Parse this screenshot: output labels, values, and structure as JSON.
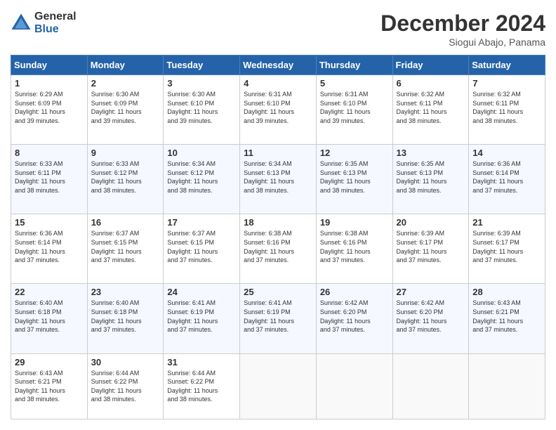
{
  "header": {
    "logo_general": "General",
    "logo_blue": "Blue",
    "month_title": "December 2024",
    "location": "Siogui Abajo, Panama"
  },
  "days_of_week": [
    "Sunday",
    "Monday",
    "Tuesday",
    "Wednesday",
    "Thursday",
    "Friday",
    "Saturday"
  ],
  "weeks": [
    [
      {
        "day": "1",
        "sunrise": "6:29 AM",
        "sunset": "6:09 PM",
        "daylight": "11 hours and 39 minutes."
      },
      {
        "day": "2",
        "sunrise": "6:30 AM",
        "sunset": "6:09 PM",
        "daylight": "11 hours and 39 minutes."
      },
      {
        "day": "3",
        "sunrise": "6:30 AM",
        "sunset": "6:10 PM",
        "daylight": "11 hours and 39 minutes."
      },
      {
        "day": "4",
        "sunrise": "6:31 AM",
        "sunset": "6:10 PM",
        "daylight": "11 hours and 39 minutes."
      },
      {
        "day": "5",
        "sunrise": "6:31 AM",
        "sunset": "6:10 PM",
        "daylight": "11 hours and 39 minutes."
      },
      {
        "day": "6",
        "sunrise": "6:32 AM",
        "sunset": "6:11 PM",
        "daylight": "11 hours and 38 minutes."
      },
      {
        "day": "7",
        "sunrise": "6:32 AM",
        "sunset": "6:11 PM",
        "daylight": "11 hours and 38 minutes."
      }
    ],
    [
      {
        "day": "8",
        "sunrise": "6:33 AM",
        "sunset": "6:11 PM",
        "daylight": "11 hours and 38 minutes."
      },
      {
        "day": "9",
        "sunrise": "6:33 AM",
        "sunset": "6:12 PM",
        "daylight": "11 hours and 38 minutes."
      },
      {
        "day": "10",
        "sunrise": "6:34 AM",
        "sunset": "6:12 PM",
        "daylight": "11 hours and 38 minutes."
      },
      {
        "day": "11",
        "sunrise": "6:34 AM",
        "sunset": "6:13 PM",
        "daylight": "11 hours and 38 minutes."
      },
      {
        "day": "12",
        "sunrise": "6:35 AM",
        "sunset": "6:13 PM",
        "daylight": "11 hours and 38 minutes."
      },
      {
        "day": "13",
        "sunrise": "6:35 AM",
        "sunset": "6:13 PM",
        "daylight": "11 hours and 38 minutes."
      },
      {
        "day": "14",
        "sunrise": "6:36 AM",
        "sunset": "6:14 PM",
        "daylight": "11 hours and 37 minutes."
      }
    ],
    [
      {
        "day": "15",
        "sunrise": "6:36 AM",
        "sunset": "6:14 PM",
        "daylight": "11 hours and 37 minutes."
      },
      {
        "day": "16",
        "sunrise": "6:37 AM",
        "sunset": "6:15 PM",
        "daylight": "11 hours and 37 minutes."
      },
      {
        "day": "17",
        "sunrise": "6:37 AM",
        "sunset": "6:15 PM",
        "daylight": "11 hours and 37 minutes."
      },
      {
        "day": "18",
        "sunrise": "6:38 AM",
        "sunset": "6:16 PM",
        "daylight": "11 hours and 37 minutes."
      },
      {
        "day": "19",
        "sunrise": "6:38 AM",
        "sunset": "6:16 PM",
        "daylight": "11 hours and 37 minutes."
      },
      {
        "day": "20",
        "sunrise": "6:39 AM",
        "sunset": "6:17 PM",
        "daylight": "11 hours and 37 minutes."
      },
      {
        "day": "21",
        "sunrise": "6:39 AM",
        "sunset": "6:17 PM",
        "daylight": "11 hours and 37 minutes."
      }
    ],
    [
      {
        "day": "22",
        "sunrise": "6:40 AM",
        "sunset": "6:18 PM",
        "daylight": "11 hours and 37 minutes."
      },
      {
        "day": "23",
        "sunrise": "6:40 AM",
        "sunset": "6:18 PM",
        "daylight": "11 hours and 37 minutes."
      },
      {
        "day": "24",
        "sunrise": "6:41 AM",
        "sunset": "6:19 PM",
        "daylight": "11 hours and 37 minutes."
      },
      {
        "day": "25",
        "sunrise": "6:41 AM",
        "sunset": "6:19 PM",
        "daylight": "11 hours and 37 minutes."
      },
      {
        "day": "26",
        "sunrise": "6:42 AM",
        "sunset": "6:20 PM",
        "daylight": "11 hours and 37 minutes."
      },
      {
        "day": "27",
        "sunrise": "6:42 AM",
        "sunset": "6:20 PM",
        "daylight": "11 hours and 37 minutes."
      },
      {
        "day": "28",
        "sunrise": "6:43 AM",
        "sunset": "6:21 PM",
        "daylight": "11 hours and 37 minutes."
      }
    ],
    [
      {
        "day": "29",
        "sunrise": "6:43 AM",
        "sunset": "6:21 PM",
        "daylight": "11 hours and 38 minutes."
      },
      {
        "day": "30",
        "sunrise": "6:44 AM",
        "sunset": "6:22 PM",
        "daylight": "11 hours and 38 minutes."
      },
      {
        "day": "31",
        "sunrise": "6:44 AM",
        "sunset": "6:22 PM",
        "daylight": "11 hours and 38 minutes."
      },
      null,
      null,
      null,
      null
    ]
  ]
}
